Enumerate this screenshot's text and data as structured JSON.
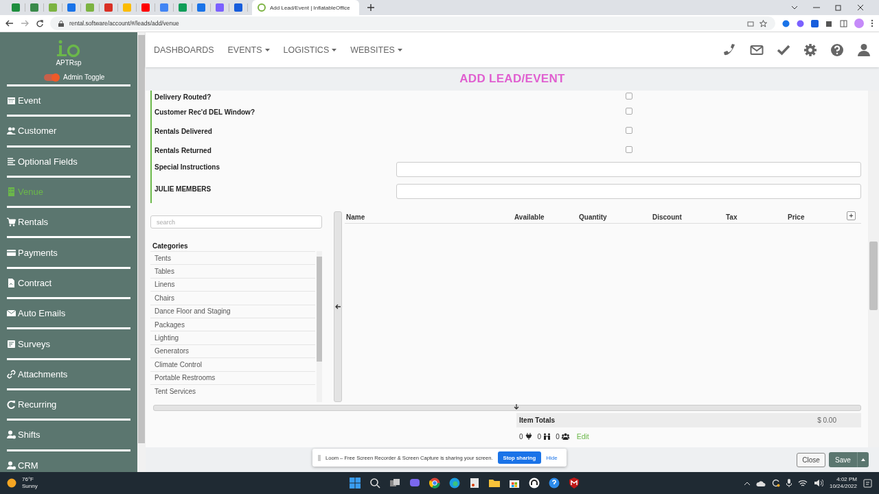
{
  "browser": {
    "pinned_tabs": [
      {
        "color": "#1e8e3e"
      },
      {
        "color": "#3a8a4a"
      },
      {
        "color": "#7cb342"
      },
      {
        "color": "#1a73e8"
      },
      {
        "color": "#7cb342"
      },
      {
        "color": "#d93025"
      },
      {
        "color": "#fbbc04"
      },
      {
        "color": "#ff0000"
      },
      {
        "color": "#4285f4"
      },
      {
        "color": "#0f9d58"
      },
      {
        "color": "#1a73e8"
      },
      {
        "color": "#7b61ff"
      },
      {
        "color": "#175ddc"
      }
    ],
    "active_tab": {
      "title": "Add Lead/Event | InflatableOffice"
    },
    "address": "rental.software/account/#/leads/add/venue"
  },
  "sidebar": {
    "account": "APTRsp",
    "admin_toggle": {
      "label": "Admin Toggle",
      "on": true
    },
    "items": [
      {
        "label": "Event",
        "selected": false
      },
      {
        "label": "Customer",
        "selected": false
      },
      {
        "label": "Optional Fields",
        "selected": false
      },
      {
        "label": "Venue",
        "selected": true
      },
      {
        "label": "Rentals",
        "selected": false
      },
      {
        "label": "Payments",
        "selected": false
      },
      {
        "label": "Contract",
        "selected": false
      },
      {
        "label": "Auto Emails",
        "selected": false
      },
      {
        "label": "Surveys",
        "selected": false
      },
      {
        "label": "Attachments",
        "selected": false
      },
      {
        "label": "Recurring",
        "selected": false
      },
      {
        "label": "Shifts",
        "selected": false
      },
      {
        "label": "CRM",
        "selected": false
      }
    ]
  },
  "nav": {
    "menus": [
      {
        "label": "DASHBOARDS",
        "dropdown": false
      },
      {
        "label": "EVENTS",
        "dropdown": true
      },
      {
        "label": "LOGISTICS",
        "dropdown": true
      },
      {
        "label": "WEBSITES",
        "dropdown": true
      }
    ]
  },
  "page_title": "ADD LEAD/EVENT",
  "form": [
    {
      "kind": "checkbox",
      "label": "Delivery Routed?",
      "checked": false
    },
    {
      "kind": "checkbox",
      "label": "Customer Rec'd DEL Window?",
      "checked": false
    },
    {
      "kind": "checkbox",
      "label": "Rentals Delivered",
      "checked": false
    },
    {
      "kind": "checkbox",
      "label": "Rentals Returned",
      "checked": false
    },
    {
      "kind": "text",
      "label": "Special Instructions"
    },
    {
      "kind": "text",
      "label": "JULIE MEMBERS"
    }
  ],
  "catalog": {
    "search": {
      "placeholder": "search"
    },
    "heading": "Categories",
    "categories": [
      "Tents",
      "Tables",
      "Linens",
      "Chairs",
      "Dance Floor and Staging",
      "Packages",
      "Lighting",
      "Generators",
      "Climate Control",
      "Portable Restrooms",
      "Tent Services"
    ]
  },
  "items_table": {
    "columns": [
      "Name",
      "Available",
      "Quantity",
      "Discount",
      "Tax",
      "Price"
    ],
    "add": "+"
  },
  "totals": {
    "label": "Item Totals",
    "amount": "$ 0.00",
    "counts": [
      "0",
      "0",
      "0"
    ],
    "edit": "Edit"
  },
  "share_bar": {
    "text": "Loom – Free Screen Recorder & Screen Capture is sharing your screen.",
    "stop": "Stop sharing",
    "hide": "Hide"
  },
  "footer": {
    "close": "Close",
    "save": "Save"
  },
  "taskbar": {
    "temperature": "76°F",
    "weather": "Sunny",
    "time": "4:02 PM",
    "date": "10/24/2022"
  }
}
